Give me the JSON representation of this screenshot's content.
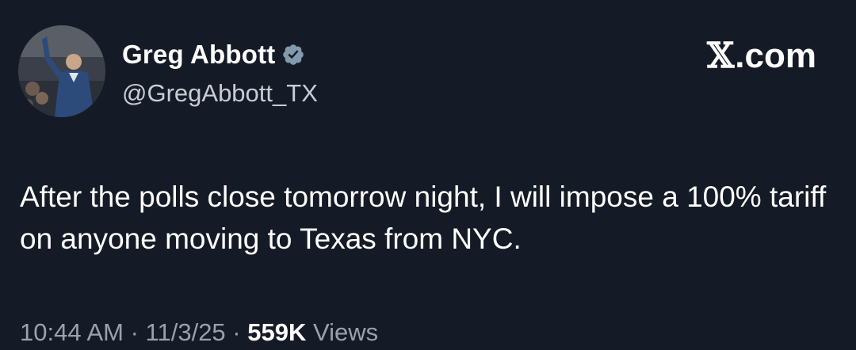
{
  "author": {
    "display_name": "Greg Abbott",
    "handle": "@GregAbbott_TX",
    "verified_icon": "verified-badge-icon",
    "avatar_icon": "profile-photo"
  },
  "site": {
    "x_glyph": "𝕏",
    "suffix": ".com"
  },
  "tweet": {
    "text": "After the polls close tomorrow night, I will impose a 100% tariff on anyone moving to Texas from NYC."
  },
  "meta": {
    "time": "10:44 AM",
    "separator": " · ",
    "date": "11/3/25",
    "views_count": "559K",
    "views_label": " Views"
  },
  "colors": {
    "background": "#151b26",
    "text": "#ffffff",
    "secondary_text": "#9aa1ab",
    "verified_badge": "#829aab"
  }
}
